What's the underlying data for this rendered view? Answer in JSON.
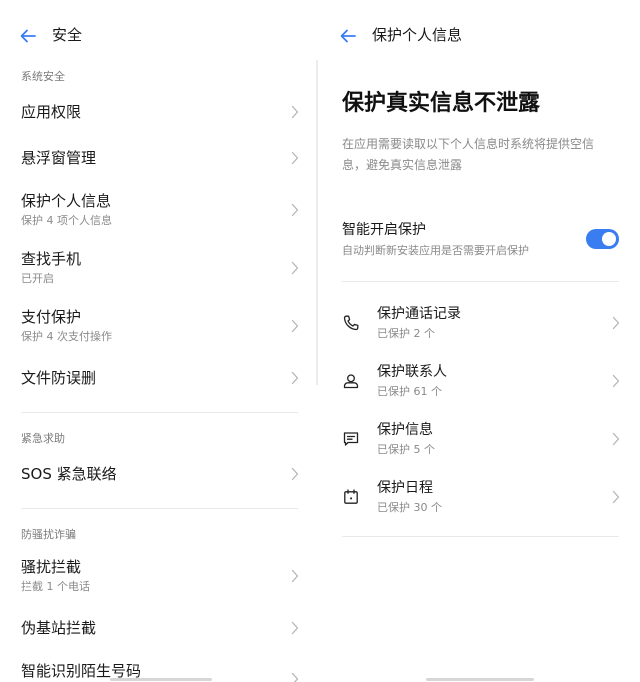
{
  "left": {
    "title": "安全",
    "sections": [
      {
        "label": "系统安全",
        "items": [
          {
            "title": "应用权限",
            "subtitle": ""
          },
          {
            "title": "悬浮窗管理",
            "subtitle": ""
          },
          {
            "title": "保护个人信息",
            "subtitle": "保护 4 项个人信息"
          },
          {
            "title": "查找手机",
            "subtitle": "已开启"
          },
          {
            "title": "支付保护",
            "subtitle": "保护 4 次支付操作"
          },
          {
            "title": "文件防误删",
            "subtitle": ""
          }
        ]
      },
      {
        "label": "紧急求助",
        "items": [
          {
            "title": "SOS 紧急联络",
            "subtitle": ""
          }
        ]
      },
      {
        "label": "防骚扰诈骗",
        "items": [
          {
            "title": "骚扰拦截",
            "subtitle": "拦截 1 个电话"
          },
          {
            "title": "伪基站拦截",
            "subtitle": ""
          },
          {
            "title": "智能识别陌生号码",
            "subtitle": ""
          }
        ]
      }
    ]
  },
  "right": {
    "title": "保护个人信息",
    "heading": "保护真实信息不泄露",
    "description": "在应用需要读取以下个人信息时系统将提供空信息，避免真实信息泄露",
    "smart_protect": {
      "title": "智能开启保护",
      "subtitle": "自动判断新安装应用是否需要开启保护",
      "enabled": true
    },
    "items": [
      {
        "icon": "phone-icon",
        "title": "保护通话记录",
        "subtitle": "已保护 2 个"
      },
      {
        "icon": "contact-icon",
        "title": "保护联系人",
        "subtitle": "已保护 61 个"
      },
      {
        "icon": "message-icon",
        "title": "保护信息",
        "subtitle": "已保护 5 个"
      },
      {
        "icon": "calendar-icon",
        "title": "保护日程",
        "subtitle": "已保护 30 个"
      }
    ]
  },
  "colors": {
    "accent": "#3a7df0",
    "text_primary": "#1a1a1a",
    "text_secondary": "#8a8a8a",
    "divider": "#e9e9e9",
    "background": "#ffffff"
  }
}
